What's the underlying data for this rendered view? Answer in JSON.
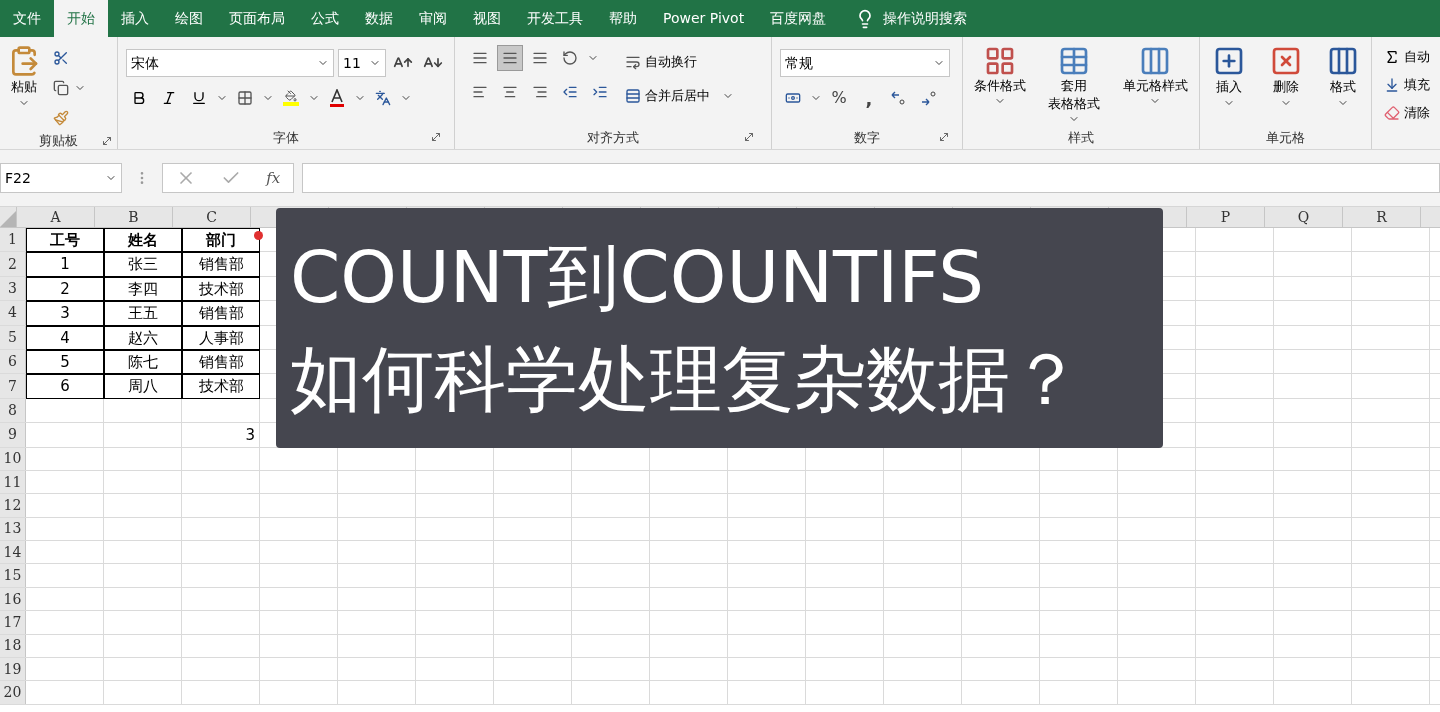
{
  "tabs": [
    {
      "label": "文件",
      "selected": false
    },
    {
      "label": "开始",
      "selected": true
    },
    {
      "label": "插入",
      "selected": false
    },
    {
      "label": "绘图",
      "selected": false
    },
    {
      "label": "页面布局",
      "selected": false
    },
    {
      "label": "公式",
      "selected": false
    },
    {
      "label": "数据",
      "selected": false
    },
    {
      "label": "审阅",
      "selected": false
    },
    {
      "label": "视图",
      "selected": false
    },
    {
      "label": "开发工具",
      "selected": false
    },
    {
      "label": "帮助",
      "selected": false
    },
    {
      "label": "Power Pivot",
      "selected": false
    },
    {
      "label": "百度网盘",
      "selected": false
    }
  ],
  "tell_me": {
    "label": "操作说明搜索"
  },
  "ribbon": {
    "clipboard": {
      "paste": "粘贴",
      "label": "剪贴板"
    },
    "font": {
      "font_name": "宋体",
      "font_size": "11",
      "label": "字体"
    },
    "alignment": {
      "vertical_align": [
        {
          "selected": false
        },
        {
          "selected": true
        },
        {
          "selected": false
        }
      ],
      "wrap_text": "自动换行",
      "merge_center": "合并后居中",
      "label": "对齐方式"
    },
    "number": {
      "format": "常规",
      "percent": "%",
      "comma": ",",
      "label": "数字"
    },
    "styles": {
      "buttons": [
        {
          "lines": [
            "条件格式"
          ]
        },
        {
          "lines": [
            "套用",
            "表格格式"
          ]
        },
        {
          "lines": [
            "单元格样式"
          ]
        }
      ],
      "label": "样式"
    },
    "cells": {
      "buttons": [
        "插入",
        "删除",
        "格式"
      ],
      "label": "单元格"
    },
    "editing": {
      "items": [
        "自动",
        "填充",
        "清除"
      ]
    }
  },
  "formula_bar": {
    "name_box": "F22",
    "fx": "fx"
  },
  "sheet": {
    "columns": [
      "A",
      "B",
      "C",
      "P",
      "Q",
      "R"
    ],
    "rows": [
      {
        "number": "1",
        "header": true,
        "bordered": true,
        "comment": true,
        "cells": [
          "工号",
          "姓名",
          "部门"
        ]
      },
      {
        "number": "2",
        "header": false,
        "bordered": true,
        "comment": false,
        "cells": [
          "1",
          "张三",
          "销售部"
        ]
      },
      {
        "number": "3",
        "header": false,
        "bordered": true,
        "comment": false,
        "cells": [
          "2",
          "李四",
          "技术部"
        ]
      },
      {
        "number": "4",
        "header": false,
        "bordered": true,
        "comment": false,
        "cells": [
          "3",
          "王五",
          "销售部"
        ]
      },
      {
        "number": "5",
        "header": false,
        "bordered": true,
        "comment": false,
        "cells": [
          "4",
          "赵六",
          "人事部"
        ]
      },
      {
        "number": "6",
        "header": false,
        "bordered": true,
        "comment": false,
        "cells": [
          "5",
          "陈七",
          "销售部"
        ]
      },
      {
        "number": "7",
        "header": false,
        "bordered": true,
        "comment": false,
        "cells": [
          "6",
          "周八",
          "技术部"
        ]
      },
      {
        "number": "8",
        "cells": []
      },
      {
        "number": "9",
        "cells": [],
        "c_value": "3"
      },
      {
        "number": "10",
        "cells": []
      },
      {
        "number": "11",
        "cells": []
      },
      {
        "number": "12",
        "cells": []
      },
      {
        "number": "13",
        "cells": []
      },
      {
        "number": "14",
        "cells": []
      },
      {
        "number": "15",
        "cells": []
      },
      {
        "number": "16",
        "cells": []
      },
      {
        "number": "17",
        "cells": []
      },
      {
        "number": "18",
        "cells": []
      },
      {
        "number": "19",
        "cells": []
      },
      {
        "number": "20",
        "cells": []
      }
    ]
  },
  "overlay": {
    "lines": [
      "COUNT到COUNTIFS",
      "如何科学处理复杂数据？"
    ]
  }
}
